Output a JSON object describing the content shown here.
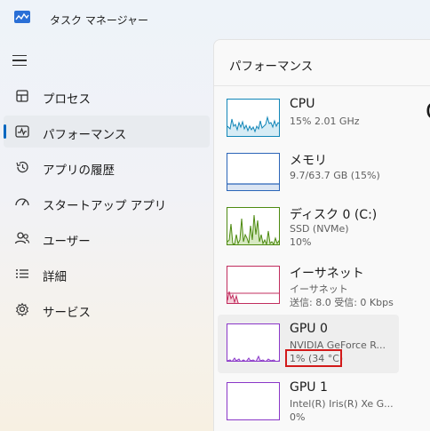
{
  "window": {
    "title": "タスク マネージャー",
    "app_icon": "task-manager-icon"
  },
  "nav": {
    "menu_icon": "hamburger-icon",
    "items": [
      {
        "label": "プロセス",
        "icon": "processes-icon",
        "active": false
      },
      {
        "label": "パフォーマンス",
        "icon": "performance-icon",
        "active": true
      },
      {
        "label": "アプリの履歴",
        "icon": "history-icon",
        "active": false
      },
      {
        "label": "スタートアップ アプリ",
        "icon": "startup-icon",
        "active": false
      },
      {
        "label": "ユーザー",
        "icon": "users-icon",
        "active": false
      },
      {
        "label": "詳細",
        "icon": "details-icon",
        "active": false
      },
      {
        "label": "サービス",
        "icon": "services-icon",
        "active": false
      }
    ]
  },
  "main": {
    "title": "パフォーマンス",
    "right_char": "C",
    "items": [
      {
        "name": "CPU",
        "sub1": "15%  2.01 GHz",
        "sub2": "",
        "color": "#1186b8",
        "fill": "#d6ecf5",
        "selected": false
      },
      {
        "name": "メモリ",
        "sub1": "9.7/63.7 GB (15%)",
        "sub2": "",
        "color": "#2b65b8",
        "fill": "#dbe5f3",
        "selected": false
      },
      {
        "name": "ディスク 0 (C:)",
        "sub1": "SSD (NVMe)",
        "sub2": "10%",
        "color": "#4d8a10",
        "fill": "#e3efd6",
        "selected": false
      },
      {
        "name": "イーサネット",
        "sub1": "イーサネット",
        "sub2": "送信: 8.0  受信: 0 Kbps",
        "color": "#c12d5e",
        "fill": "#f5d6df",
        "selected": false
      },
      {
        "name": "GPU 0",
        "sub1": "NVIDIA GeForce R...",
        "sub2": "1%  (34 °C)",
        "color": "#8a37c8",
        "fill": "#ecdcf6",
        "selected": true
      },
      {
        "name": "GPU 1",
        "sub1": "Intel(R) Iris(R) Xe G...",
        "sub2": "0%",
        "color": "#8a37c8",
        "fill": "#ecdcf6",
        "selected": false
      }
    ]
  },
  "colors": {
    "accent": "#0067c0",
    "highlight": "#d21a1a"
  }
}
